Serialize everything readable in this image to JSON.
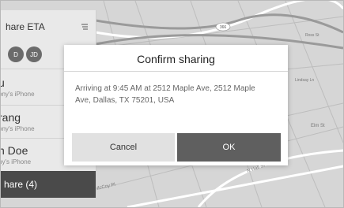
{
  "panel": {
    "title": "hare ETA",
    "avatars": [
      "D",
      "JD"
    ],
    "contacts": [
      {
        "name": "u",
        "subtitle": "ony's iPhone"
      },
      {
        "name": "rang",
        "subtitle": "ony's iPhone"
      },
      {
        "name": "n Doe",
        "subtitle": "ny's iPhone"
      }
    ],
    "share_label": "hare (4)"
  },
  "map": {
    "route_badge": "366",
    "streets": [
      "Ross St",
      "Elm St",
      "N Hall St",
      "McCoy Pl",
      "Lindsay Ln"
    ]
  },
  "dialog": {
    "title": "Confirm sharing",
    "message": "Arriving at  9:45 AM at 2512 Maple Ave, 2512 Maple Ave, Dallas, TX 75201, USA",
    "cancel_label": "Cancel",
    "ok_label": "OK"
  }
}
